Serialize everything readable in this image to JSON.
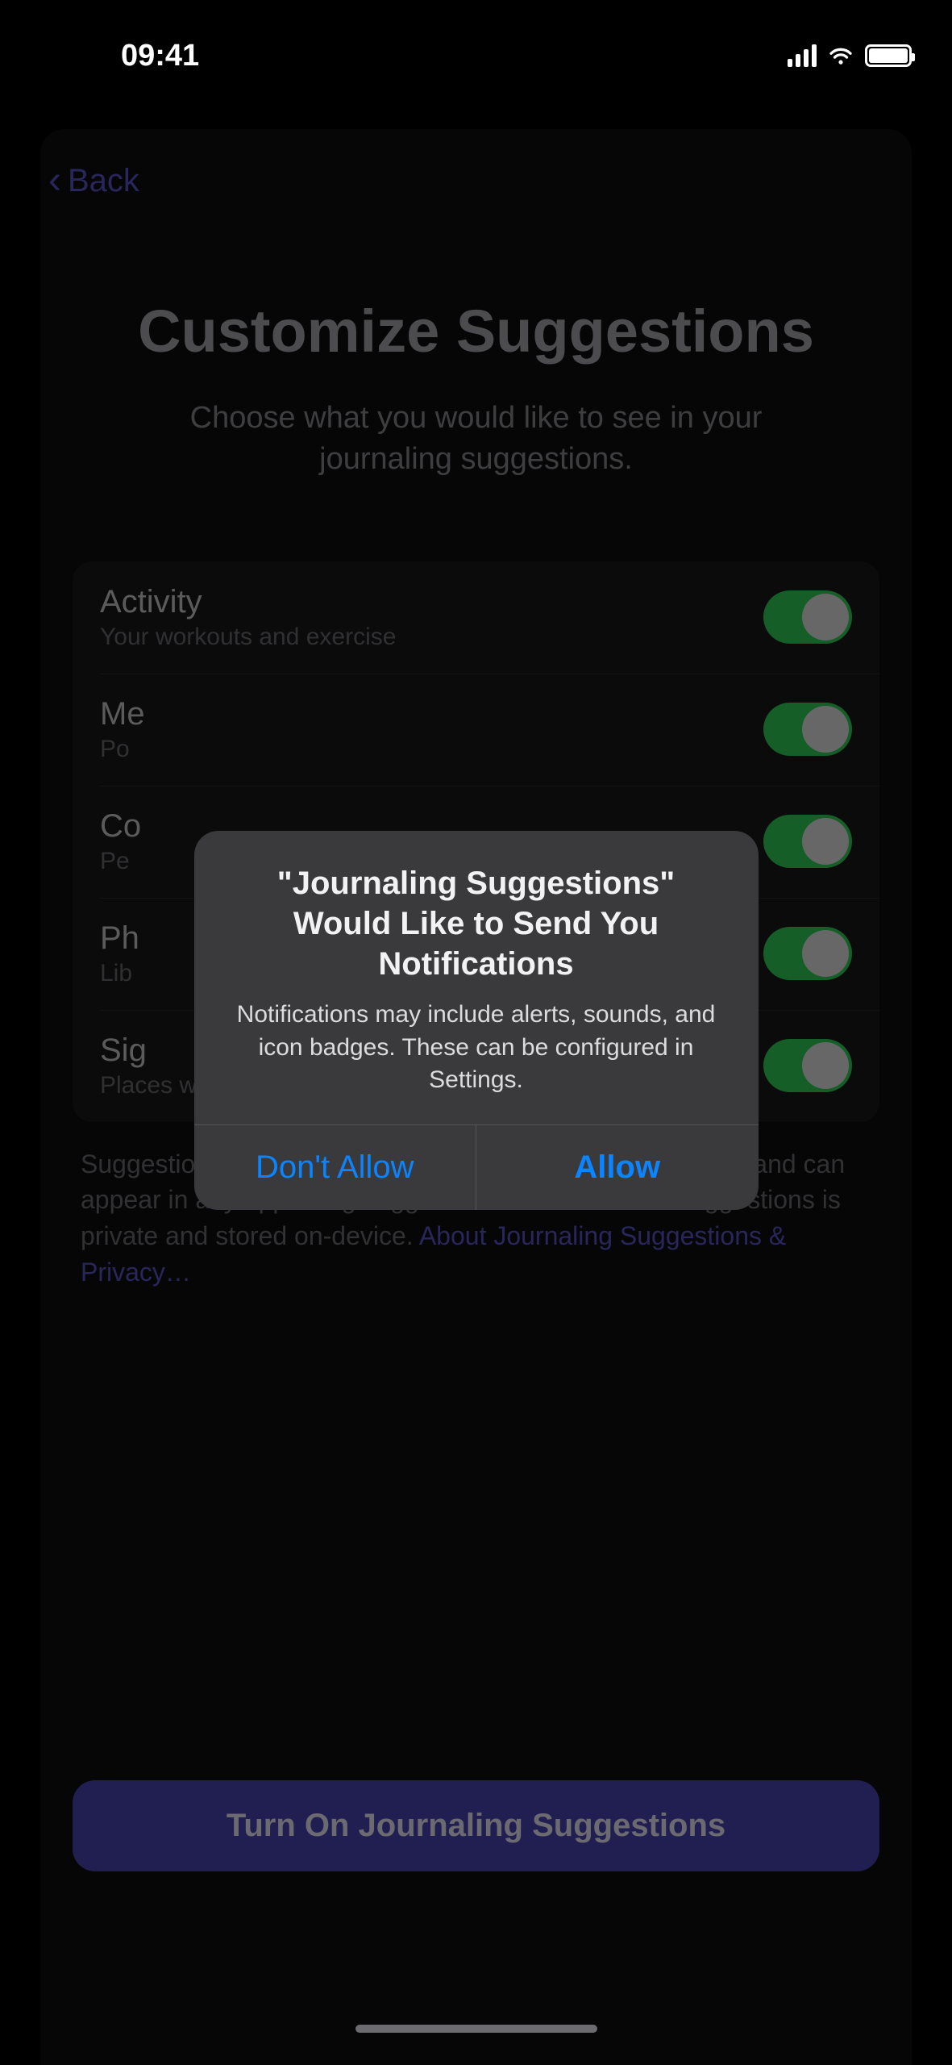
{
  "status": {
    "time": "09:41"
  },
  "nav": {
    "back_label": "Back"
  },
  "page": {
    "title": "Customize Suggestions",
    "subtitle": "Choose what you would like to see in your journaling suggestions."
  },
  "options": [
    {
      "title": "Activity",
      "subtitle": "Your workouts and exercise",
      "on": true
    },
    {
      "title": "Me",
      "subtitle": "Po",
      "on": true
    },
    {
      "title": "Co",
      "subtitle": "Pe",
      "on": true
    },
    {
      "title": "Ph",
      "subtitle": "Lib",
      "on": true
    },
    {
      "title": "Sig",
      "subtitle": "Places where you spend time",
      "on": true
    }
  ],
  "footer": {
    "text": "Suggestions use data from apps and services you turn on, and can appear in any app using suggestions. Data used for suggestions is private and stored on-device. ",
    "link": "About Journaling Suggestions & Privacy…"
  },
  "primary_button": "Turn On Journaling Suggestions",
  "alert": {
    "title": "\"Journaling Suggestions\" Would Like to Send You Notifications",
    "message": "Notifications may include alerts, sounds, and icon badges. These can be configured in Settings.",
    "dont_allow": "Don't Allow",
    "allow": "Allow"
  }
}
